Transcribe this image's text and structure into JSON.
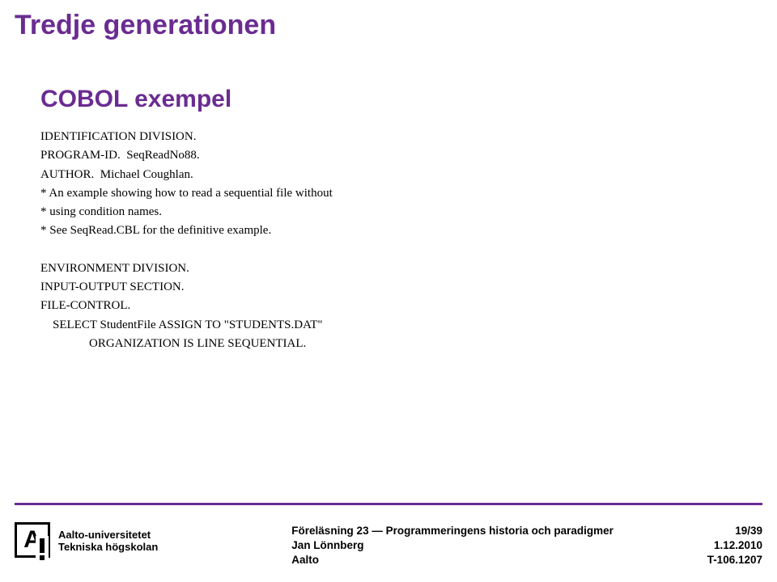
{
  "title": "Tredje generationen",
  "subtitle": "COBOL exempel",
  "code": {
    "lines": [
      "IDENTIFICATION DIVISION.",
      "PROGRAM-ID.  SeqReadNo88.",
      "AUTHOR.  Michael Coughlan.",
      "* An example showing how to read a sequential file without",
      "* using condition names.",
      "* See SeqRead.CBL for the definitive example.",
      "",
      "ENVIRONMENT DIVISION.",
      "INPUT-OUTPUT SECTION.",
      "FILE-CONTROL.",
      "    SELECT StudentFile ASSIGN TO \"STUDENTS.DAT\"",
      "\t\tORGANIZATION IS LINE SEQUENTIAL."
    ]
  },
  "footer": {
    "logo": {
      "letter": "A",
      "line1": "Aalto-universitetet",
      "line2": "Tekniska högskolan"
    },
    "center": {
      "line1": "Föreläsning 23 — Programmeringens historia och paradigmer",
      "line2": "Jan Lönnberg",
      "line3": "Aalto"
    },
    "right": {
      "page": "19/39",
      "date": "1.12.2010",
      "course": "T-106.1207"
    }
  }
}
